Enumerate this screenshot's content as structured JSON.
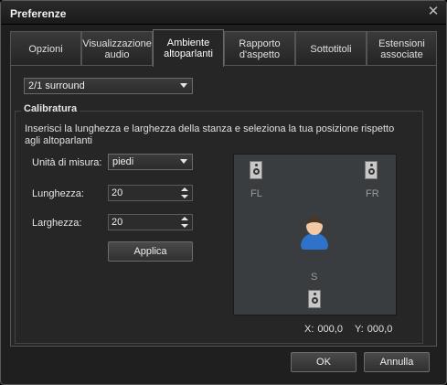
{
  "window": {
    "title": "Preferenze"
  },
  "tabs": [
    {
      "label": "Opzioni"
    },
    {
      "label": "Visualizzazione audio"
    },
    {
      "label": "Ambiente altoparlanti"
    },
    {
      "label": "Rapporto d'aspetto"
    },
    {
      "label": "Sottotitoli"
    },
    {
      "label": "Estensioni associate"
    }
  ],
  "active_tab": "Ambiente altoparlanti",
  "speaker_mode": {
    "value": "2/1 surround"
  },
  "calibration": {
    "title": "Calibratura",
    "description": "Inserisci la lunghezza e larghezza della stanza e seleziona la tua posizione rispetto agli altoparlanti",
    "unit": {
      "label": "Unità di misura:",
      "value": "piedi"
    },
    "length": {
      "label": "Lunghezza:",
      "value": "20"
    },
    "width": {
      "label": "Larghezza:",
      "value": "20"
    },
    "apply_label": "Applica"
  },
  "room": {
    "speakers": [
      {
        "label": "FL",
        "icon": "speaker-icon"
      },
      {
        "label": "FR",
        "icon": "speaker-icon"
      },
      {
        "label": "S",
        "icon": "speaker-icon"
      }
    ],
    "listener_icon": "user-avatar-icon",
    "coords": {
      "x_label": "X:",
      "x_value": "000,0",
      "y_label": "Y:",
      "y_value": "000,0"
    }
  },
  "footer": {
    "ok_label": "OK",
    "cancel_label": "Annulla"
  },
  "colors": {
    "background": "#1f1f1f",
    "panel": "#262626",
    "room": "#3a3d40",
    "accent_blue": "#2e72c9"
  }
}
